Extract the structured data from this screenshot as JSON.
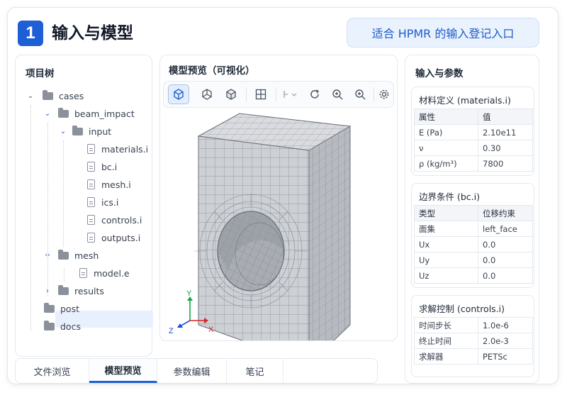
{
  "header": {
    "badge": "1",
    "title": "输入与模型",
    "pill": "适合 HPMR 的输入登记入口"
  },
  "project_tree": {
    "title": "项目树",
    "items": [
      {
        "label": "cases"
      },
      {
        "label": "beam_impact"
      },
      {
        "label": "input"
      },
      {
        "label": "materials.i"
      },
      {
        "label": "bc.i"
      },
      {
        "label": "mesh.i"
      },
      {
        "label": "ics.i"
      },
      {
        "label": "controls.i"
      },
      {
        "label": "outputs.i"
      },
      {
        "label": "mesh"
      },
      {
        "label": "model.e"
      },
      {
        "label": "results"
      },
      {
        "label": "post"
      },
      {
        "label": "docs"
      }
    ]
  },
  "preview": {
    "title": "模型预览（可视化）",
    "toolbar": [
      "view-3d-icon",
      "view-front-icon",
      "view-side-icon",
      "grid-icon",
      "slice-icon",
      "rotate-icon",
      "zoom-in-icon",
      "zoom-out-icon",
      "settings-icon"
    ],
    "axes": {
      "y": "Y",
      "z": "Z",
      "x": "X"
    }
  },
  "params": {
    "title": "输入与参数",
    "sections": [
      {
        "title": "材料定义 (materials.i)",
        "header": [
          "属性",
          "值"
        ],
        "rows": [
          [
            "E (Pa)",
            "2.10e11"
          ],
          [
            "ν",
            "0.30"
          ],
          [
            "ρ (kg/m³)",
            "7800"
          ]
        ]
      },
      {
        "title": "边界条件 (bc.i)",
        "header": [
          "类型",
          "位移约束"
        ],
        "rows": [
          [
            "面集",
            "left_face"
          ],
          [
            "Ux",
            "0.0"
          ],
          [
            "Uy",
            "0.0"
          ],
          [
            "Uz",
            "0.0"
          ]
        ]
      },
      {
        "title": "求解控制 (controls.i)",
        "rows": [
          [
            "时间步长",
            "1.0e-6"
          ],
          [
            "终止时间",
            "2.0e-3"
          ],
          [
            "求解器",
            "PETSc"
          ]
        ]
      }
    ]
  },
  "bottom_tabs": [
    "文件浏览",
    "模型预览",
    "参数编辑",
    "笔记"
  ],
  "active_tab": 1,
  "colors": {
    "accent": "#1e5fd6",
    "pill_bg": "#eaf2fe",
    "mesh_face": "#c9ccd1"
  }
}
